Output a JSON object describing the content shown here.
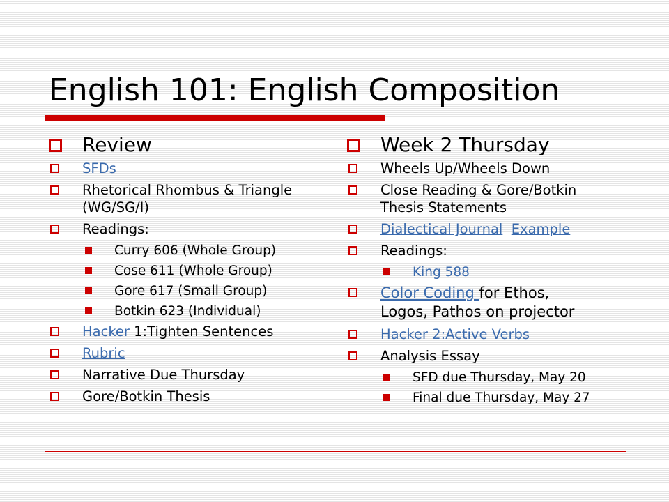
{
  "slide": {
    "title": "English 101: English Composition"
  },
  "left": {
    "heading": "Review",
    "sfds": "SFDs",
    "rhombus_line1": "Rhetorical Rhombus & Triangle",
    "rhombus_line2": "(WG/SG/I)",
    "readings_label": "Readings:",
    "readings": [
      "Curry 606 (Whole Group)",
      "Cose 611 (Whole Group)",
      "Gore 617 (Small Group)",
      "Botkin 623 (Individual)"
    ],
    "hacker_link": "Hacker",
    "hacker_text": " 1:Tighten Sentences",
    "rubric": "Rubric",
    "narrative": "Narrative Due Thursday",
    "thesis": "Gore/Botkin Thesis"
  },
  "right": {
    "heading": "Week 2 Thursday",
    "wheels": "Wheels Up/Wheels Down",
    "close_line1": "Close Reading & Gore/Botkin",
    "close_line2": "Thesis Statements",
    "journal_link": "Dialectical Journal",
    "example_link": "Example",
    "readings_label": "Readings:",
    "king_link": "King 588",
    "color_link": "Color Coding ",
    "color_text": "for Ethos,",
    "color_line2": "Logos, Pathos on projector",
    "hacker_link": "Hacker",
    "verbs_link": "2:Active Verbs",
    "analysis": "Analysis Essay",
    "sfd_due": "SFD due Thursday, May 20",
    "final_due": "Final due Thursday, May 27"
  },
  "colors": {
    "accent": "#cc0000",
    "link": "#3a6aad"
  }
}
